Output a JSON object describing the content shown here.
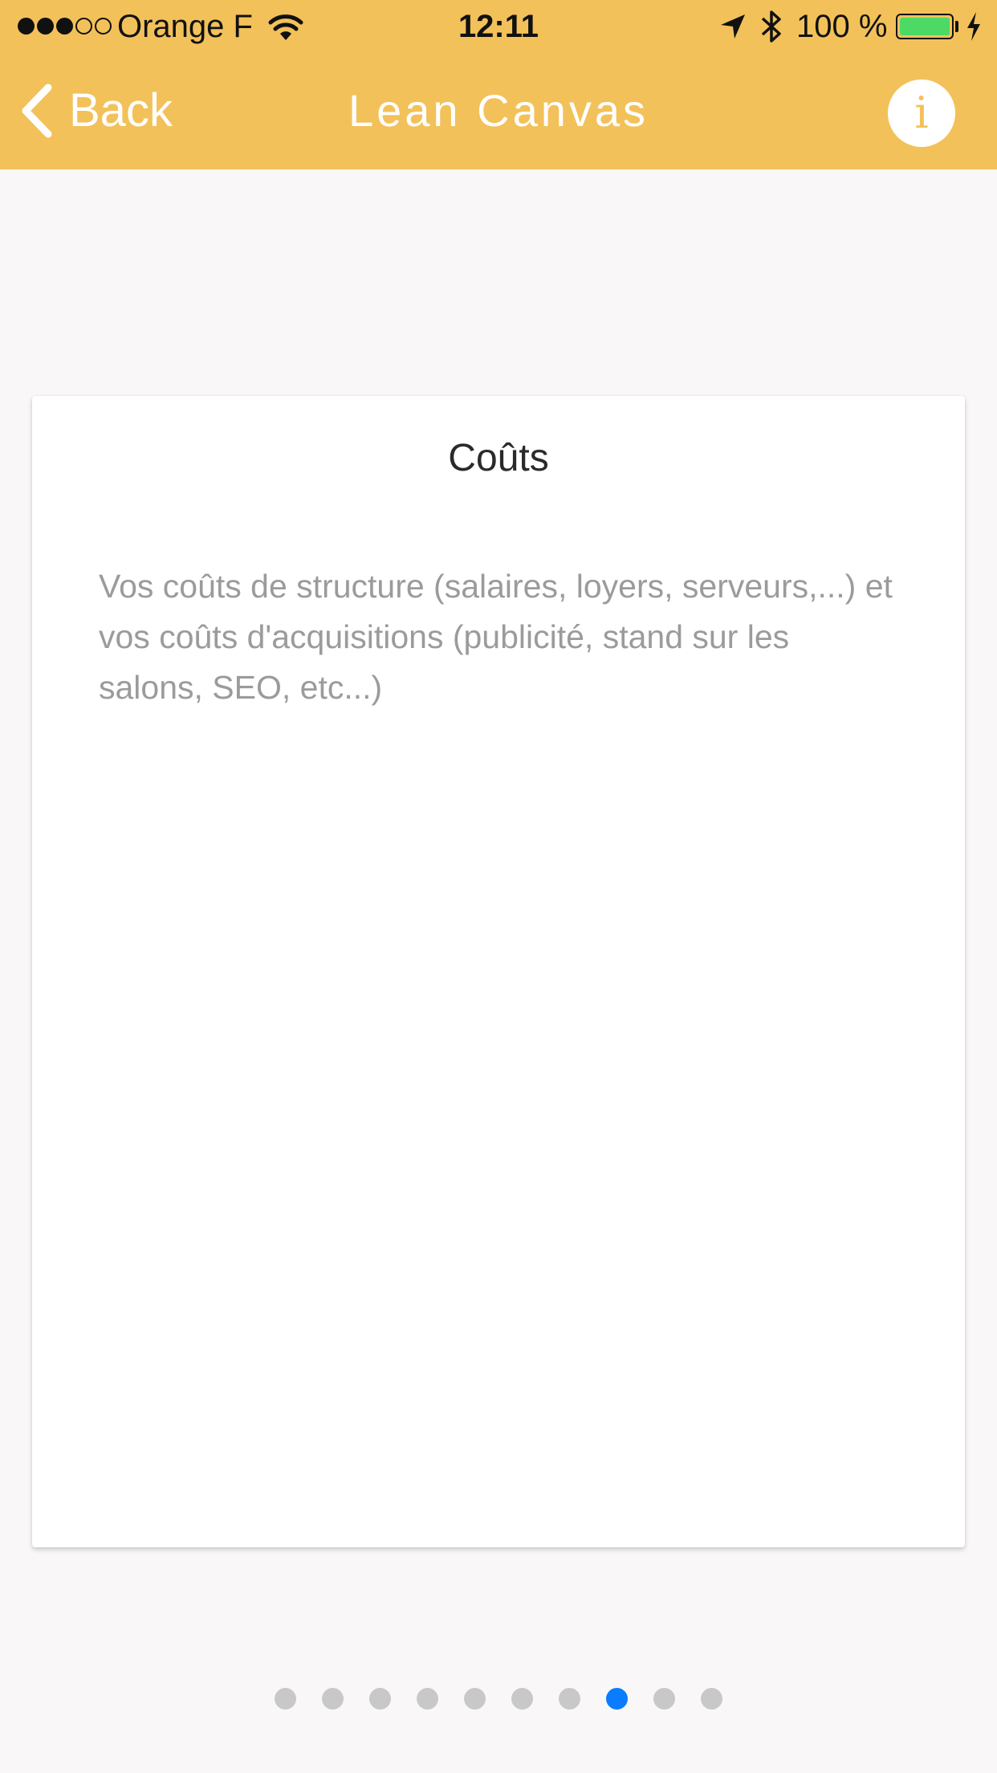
{
  "status_bar": {
    "signal_bars_filled": 3,
    "signal_bars_total": 5,
    "carrier": "Orange F",
    "time": "12:11",
    "battery_percent": "100 %",
    "battery_level": 1.0,
    "icons": [
      "wifi-icon",
      "location-arrow-icon",
      "bluetooth-icon",
      "battery-icon",
      "charging-bolt-icon"
    ]
  },
  "nav_bar": {
    "back_label": "Back",
    "title": "Lean Canvas",
    "info_glyph": "i"
  },
  "card": {
    "title": "Coûts",
    "description": "Vos coûts de structure (salaires, loyers, serveurs,...) et vos coûts d'acquisitions (publicité, stand sur les salons, SEO, etc...)"
  },
  "pager": {
    "total_pages": 10,
    "current_page": 8
  },
  "colors": {
    "header_background": "#f3c15a",
    "page_background": "#f9f7f8",
    "active_page_dot": "#0a7cff",
    "inactive_page_dot": "#c8c8c8",
    "battery_fill": "#4cd964",
    "card_description_text": "#9b9b9b"
  }
}
